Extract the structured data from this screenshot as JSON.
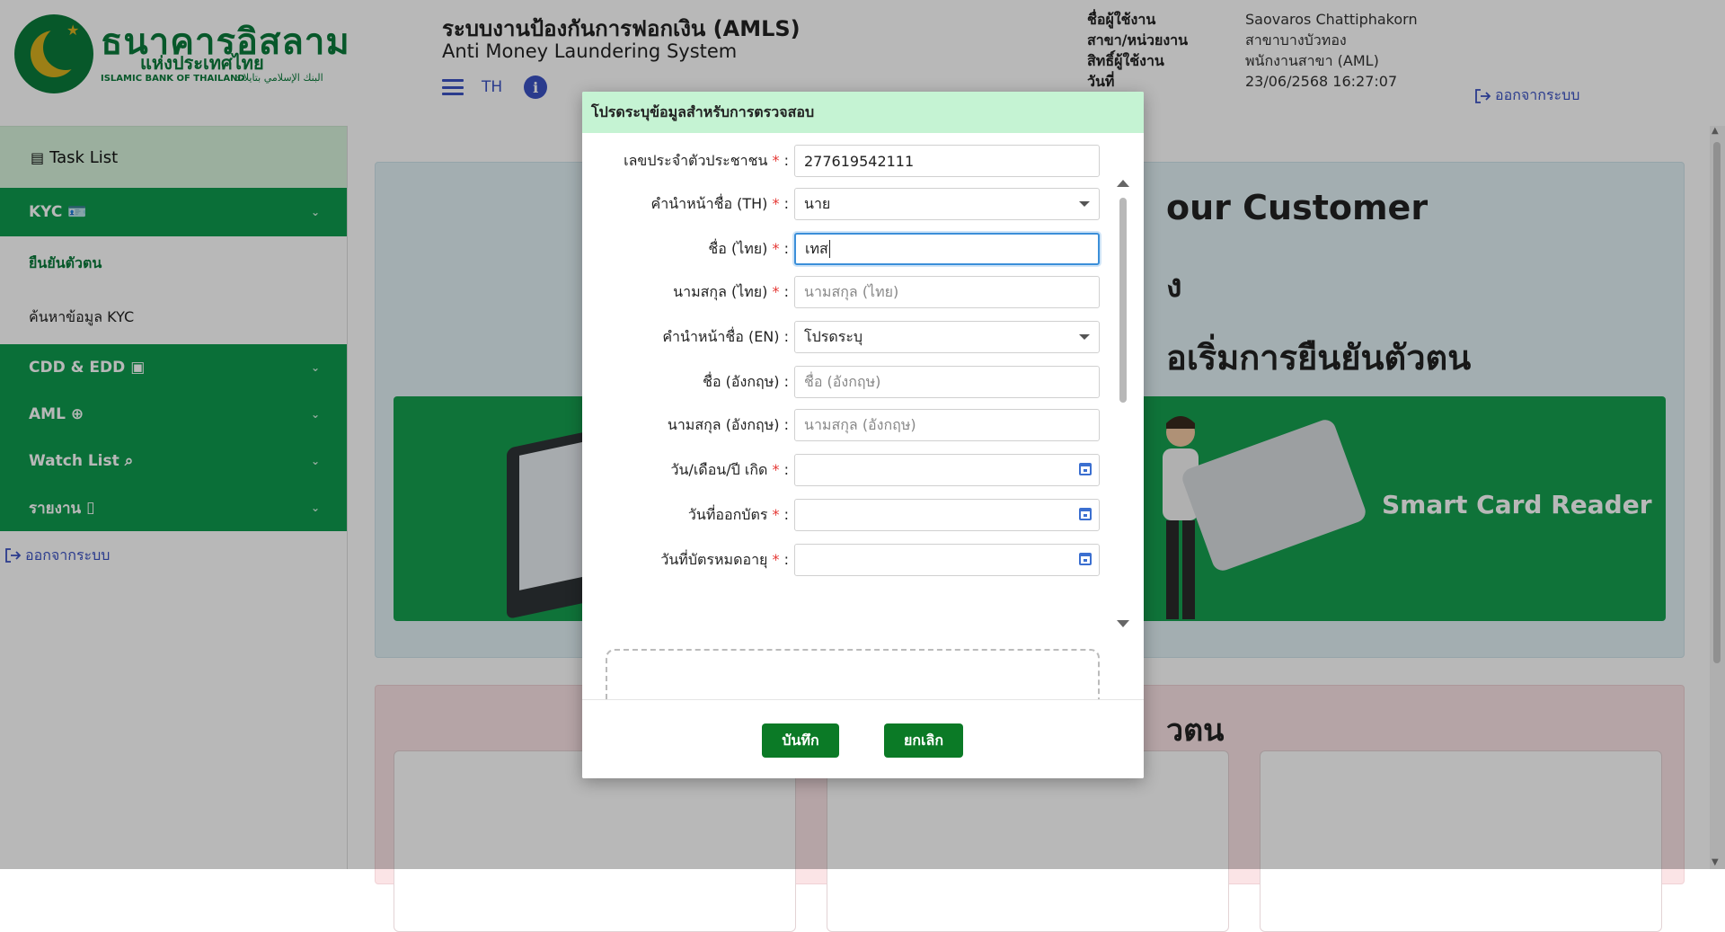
{
  "header": {
    "logo_thai": "ธนาคารอิสลาม",
    "logo_sub": "แห่งประเทศไทย",
    "logo_en": "ISLAMIC BANK OF THAILAND",
    "logo_ar": "البنك الإسلامي بتايلاند",
    "title": "ระบบงานป้องกันการฟอกเงิน (AMLS)",
    "subtitle": "Anti Money Laundering System",
    "lang": "TH",
    "user_labels": [
      "ชื่อผู้ใช้งาน",
      "สาขา/หน่วยงาน",
      "สิทธิ์ผู้ใช้งาน",
      "วันที่"
    ],
    "user_values": [
      "Saovaros Chattiphakorn",
      "สาขาบางบัวทอง",
      "พนักงานสาขา (AML)",
      "23/06/2568 16:27:07"
    ],
    "logout": "ออกจากระบบ"
  },
  "sidebar": {
    "task_list": "Task List",
    "kyc": "KYC",
    "kyc_items": [
      "ยืนยันตัวตน",
      "ค้นหาข้อมูล KYC"
    ],
    "groups": [
      "CDD & EDD",
      "AML",
      "Watch List",
      "รายงาน"
    ],
    "logout": "ออกจากระบบ"
  },
  "main": {
    "heading1": "our Customer",
    "heading2": "ง",
    "heading3": "อเริ่มการยืนยันตัวตน",
    "banner_text": "Smart Card Reader",
    "section2_title": "วตน"
  },
  "modal": {
    "title": "โปรดระบุข้อมูลสำหรับการตรวจสอบ",
    "fields": [
      {
        "label": "เลขประจำตัวประชาชน",
        "required": "*",
        "value": "277619542111",
        "placeholder": ""
      },
      {
        "label": "คำนำหน้าชื่อ (TH)",
        "required": "*",
        "value": "นาย",
        "placeholder": ""
      },
      {
        "label": "ชื่อ (ไทย)",
        "required": "*",
        "value": "เทส",
        "placeholder": ""
      },
      {
        "label": "นามสกุล (ไทย)",
        "required": "*",
        "value": "",
        "placeholder": "นามสกุล (ไทย)"
      },
      {
        "label": "คำนำหน้าชื่อ (EN)",
        "required": "",
        "value": "โปรดระบุ",
        "placeholder": ""
      },
      {
        "label": "ชื่อ (อังกฤษ)",
        "required": "",
        "value": "",
        "placeholder": "ชื่อ (อังกฤษ)"
      },
      {
        "label": "นามสกุล (อังกฤษ)",
        "required": "",
        "value": "",
        "placeholder": "นามสกุล (อังกฤษ)"
      },
      {
        "label": "วัน/เดือน/ปี เกิด",
        "required": "*",
        "value": "",
        "placeholder": ""
      },
      {
        "label": "วันที่ออกบัตร",
        "required": "*",
        "value": "",
        "placeholder": ""
      },
      {
        "label": "วันที่บัตรหมดอายุ",
        "required": "*",
        "value": "",
        "placeholder": ""
      }
    ],
    "save": "บันทึก",
    "cancel": "ยกเลิก"
  },
  "colors": {
    "brand_green": "#0b7a3b",
    "sidebar_green": "#0e9a4e",
    "modal_header": "#c5f3d3",
    "button_green": "#0b7a26",
    "link_blue": "#3b52c4",
    "required_red": "#e53935"
  }
}
